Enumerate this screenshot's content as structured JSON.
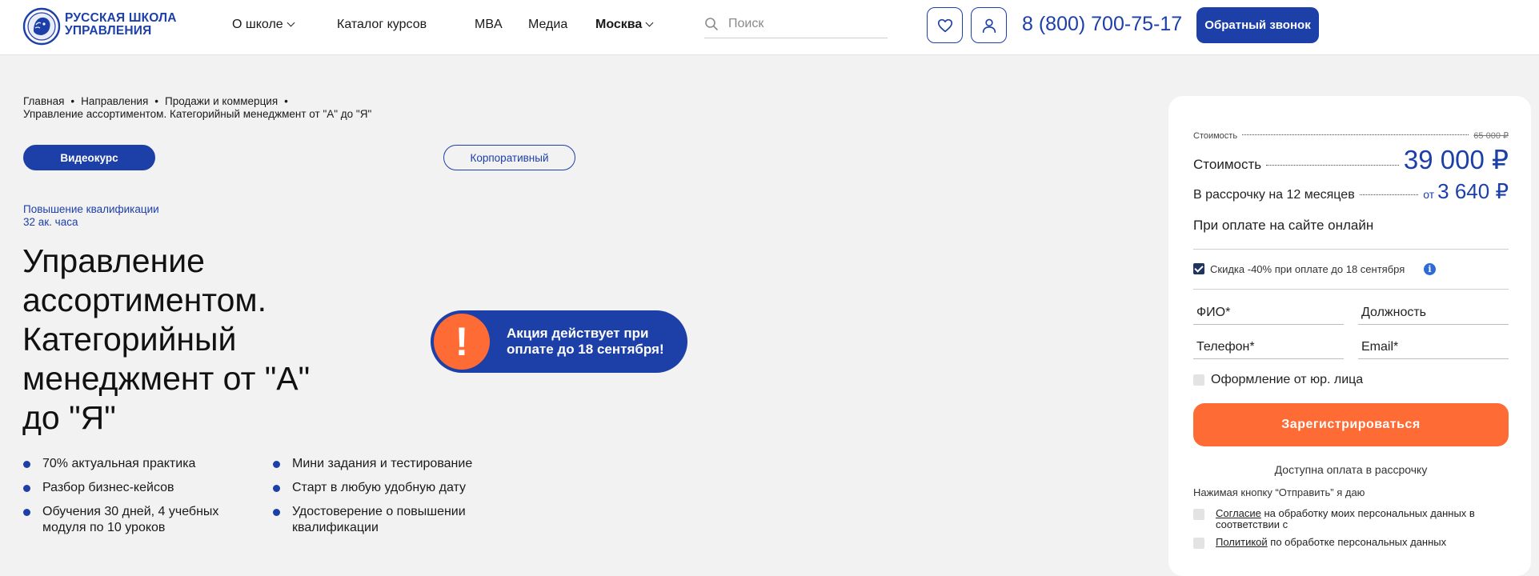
{
  "header": {
    "logo_line1": "РУССКАЯ ШКОЛА",
    "logo_line2": "УПРАВЛЕНИЯ",
    "nav": {
      "about": "О школе",
      "catalog": "Каталог курсов",
      "mba": "MBA",
      "media": "Медиа",
      "city": "Москва"
    },
    "search_placeholder": "Поиск",
    "phone": "8 (800) 700-75-17",
    "callback_label": "Обратный звонок"
  },
  "breadcrumb": {
    "items": [
      "Главная",
      "Направления",
      "Продажи и коммерция"
    ],
    "current": "Управление ассортиментом. Категорийный менеджмент от \"А\" до \"Я\""
  },
  "course": {
    "type_active": "Видеокурс",
    "type_other": "Корпоративный",
    "category": "Повышение квалификации",
    "hours": "32 ак. часа",
    "title": "Управление ассортиментом. Категорийный менеджмент от \"А\" до \"Я\""
  },
  "promo": {
    "icon_glyph": "!",
    "text": "Акция действует при оплате до 18 сентября!"
  },
  "features": [
    "70% актуальная практика",
    "Разбор бизнес-кейсов",
    "Обучения 30 дней, 4 учебных модуля по 10 уроков",
    "Мини задания и тестирование",
    "Старт в любую удобную дату",
    "Удостоверение о повышении квалификации"
  ],
  "pricing": {
    "old_label": "Стоимость",
    "old_price": "65 000 ₽",
    "label": "Стоимость",
    "price": "39 000 ₽",
    "installment_label": "В рассрочку на 12 месяцев",
    "installment_prefix": "от",
    "installment_price": "3 640 ₽",
    "online_label": "При оплате на сайте онлайн",
    "discount": "Скидка -40% при оплате до 18 сентября",
    "info_glyph": "i"
  },
  "form": {
    "name_placeholder": "ФИО*",
    "position_placeholder": "Должность",
    "phone_placeholder": "Телефон*",
    "email_placeholder": "Email*",
    "legal_entity": "Оформление от юр. лица",
    "submit_label": "Зарегистрироваться",
    "installment_note": "Доступна оплата в рассрочку",
    "consent_intro": "Нажимая кнопку “Отправить” я даю",
    "consent1_link": "Согласие",
    "consent1_rest": " на обработку моих персональных данных в соответствии с",
    "consent2_link": "Политикой",
    "consent2_rest": " по обработке персональных данных"
  },
  "colors": {
    "brand_blue": "#1d3fa8",
    "accent_orange": "#ff6b35",
    "page_bg": "#f2f2f2"
  }
}
